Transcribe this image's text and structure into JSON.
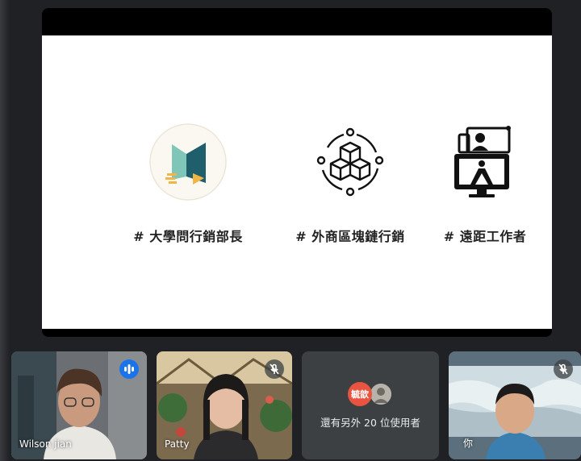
{
  "slide": {
    "items": [
      {
        "label": "# 大學問行銷部長",
        "icon": "brand-logo-icon"
      },
      {
        "label": "# 外商區塊鏈行銷",
        "icon": "blockchain-cubes-icon"
      },
      {
        "label": "# 遠距工作者",
        "icon": "remote-work-icon"
      }
    ]
  },
  "participants": [
    {
      "name": "Wilson jian",
      "status": "speaking"
    },
    {
      "name": "Patty",
      "status": "muted"
    },
    {
      "name": "你",
      "status": "muted"
    }
  ],
  "others": {
    "avatar_initials": "毓歆",
    "count_text": "還有另外 20 位使用者"
  },
  "colors": {
    "active_border": "#8ab4f8",
    "speaking_badge": "#1a73e8",
    "background": "#202124",
    "tile": "#3c4043"
  }
}
